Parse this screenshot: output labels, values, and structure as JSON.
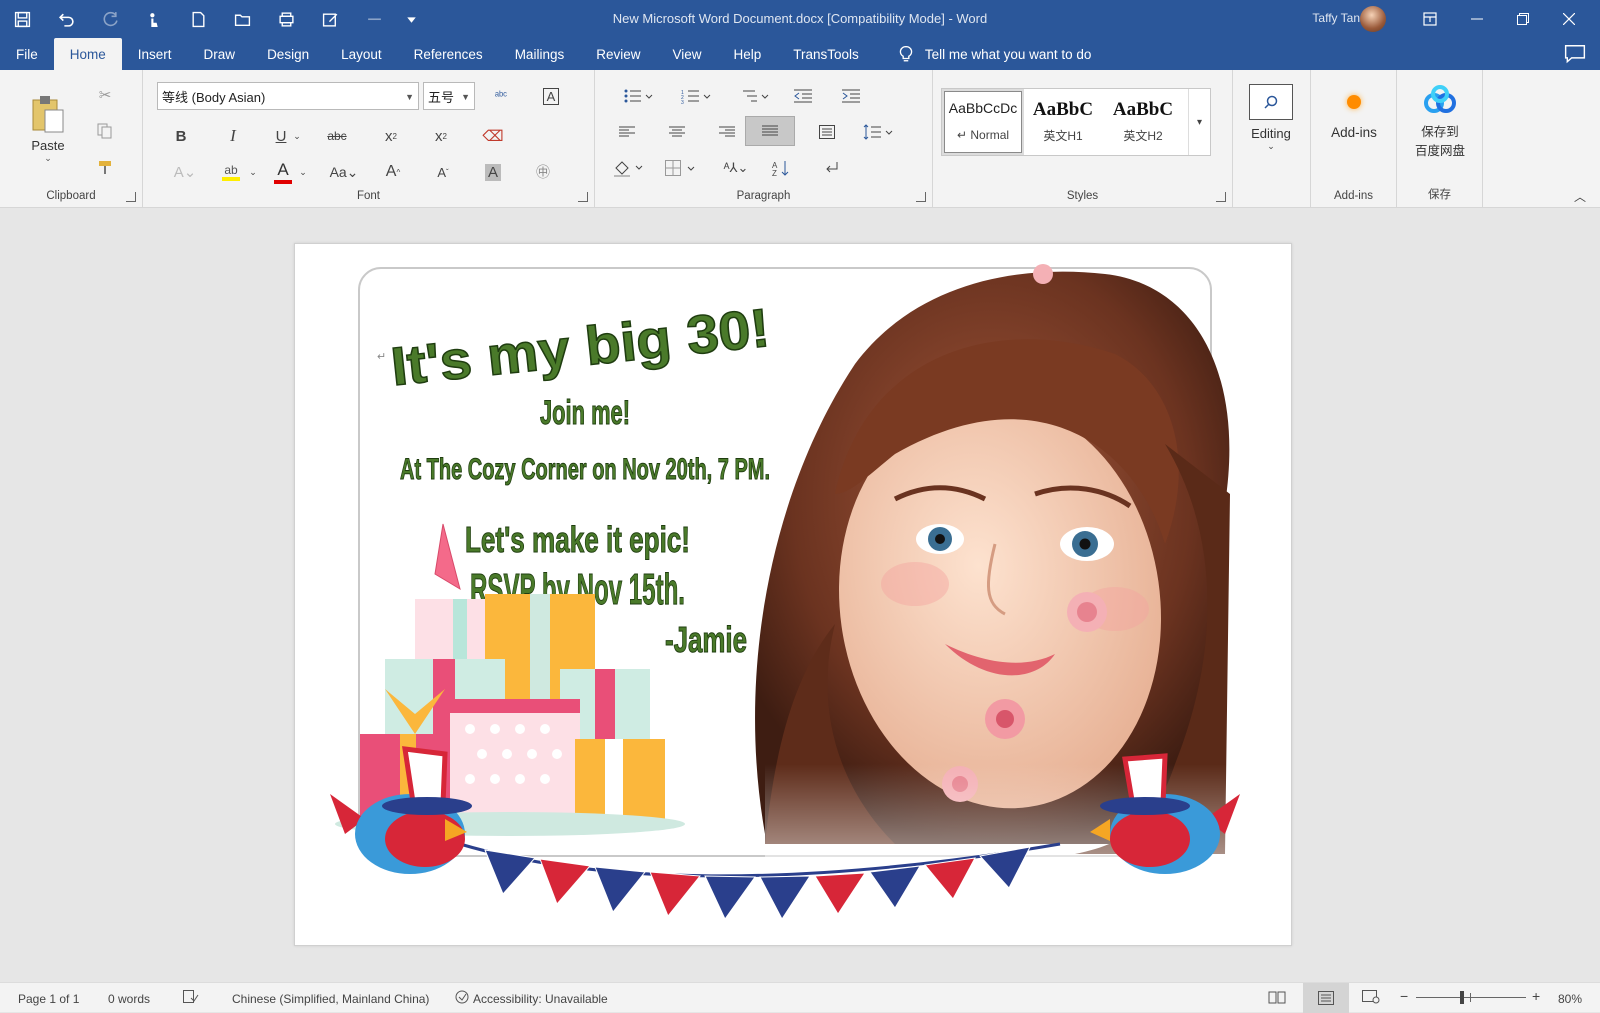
{
  "titlebar": {
    "document_title": "New Microsoft Word Document.docx [Compatibility Mode]  -  Word",
    "user_name": "Taffy Tan",
    "brand_color": "#2b579a"
  },
  "menu": {
    "tabs": [
      "File",
      "Home",
      "Insert",
      "Draw",
      "Design",
      "Layout",
      "References",
      "Mailings",
      "Review",
      "View",
      "Help",
      "TransTools"
    ],
    "active_tab": "Home",
    "tell_me": "Tell me what you want to do"
  },
  "ribbon": {
    "clipboard": {
      "paste_label": "Paste",
      "group_label": "Clipboard"
    },
    "font": {
      "font_name": "等线 (Body Asian)",
      "font_size": "五号",
      "group_label": "Font"
    },
    "paragraph": {
      "group_label": "Paragraph"
    },
    "styles": {
      "group_label": "Styles",
      "items": [
        {
          "preview": "AaBbCcDc",
          "name": "↵ Normal"
        },
        {
          "preview": "AaBbC",
          "name": "英文H1"
        },
        {
          "preview": "AaBbC",
          "name": "英文H2"
        }
      ]
    },
    "editing": {
      "label": "Editing"
    },
    "addins": {
      "label": "Add-ins",
      "group_label": "Add-ins"
    },
    "save": {
      "label_line1": "保存到",
      "label_line2": "百度网盘",
      "group_label": "保存"
    }
  },
  "document": {
    "headline": "It's my big 30!",
    "line1": "Join me!",
    "line2": "At The Cozy Corner on Nov 20th, 7 PM.",
    "line3": "Let's make it epic!",
    "line4": "RSVP by Nov 15th.",
    "signature": "-Jamie",
    "text_color": "#4a7a2a"
  },
  "status": {
    "page": "Page 1 of 1",
    "words": "0 words",
    "language": "Chinese (Simplified, Mainland China)",
    "accessibility": "Accessibility: Unavailable",
    "zoom": "80%"
  }
}
